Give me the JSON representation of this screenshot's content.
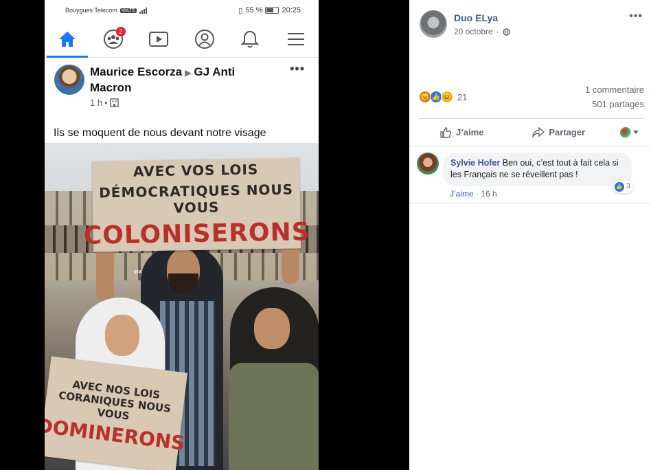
{
  "phone": {
    "status_bar": {
      "carrier": "Bouygues Telecom",
      "network_badge": "VoLTE",
      "battery": "55 %",
      "time": "20:25"
    },
    "nav_icons": [
      "home-icon",
      "groups-icon",
      "watch-icon",
      "profile-icon",
      "notifications-icon",
      "menu-icon"
    ],
    "groups_badge": "2",
    "post": {
      "author": "Maurice Escorza",
      "target": "GJ Anti Macron",
      "time": "1 h",
      "text": "Ils se moquent de nous devant notre visage",
      "sign_top": {
        "line1": "AVEC VOS LOIS",
        "line2": "DÉMOCRATIQUES NOUS VOUS",
        "line3": "COLONISERONS"
      },
      "sign_bottom": {
        "line1": "AVEC NOS LOIS",
        "line2": "CORANIQUES NOUS VOUS",
        "line3": "DOMINERONS"
      },
      "storefront": "WALL STREET"
    }
  },
  "panel": {
    "author": "Duo ELya",
    "date": "20 octobre",
    "reaction_count": "21",
    "comments_count": "1 commentaire",
    "shares_count": "501 partages",
    "like_label": "J’aime",
    "share_label": "Partager",
    "comment": {
      "author": "Sylvie Hofer",
      "text": "Ben oui, c’est tout à fait cela si les Français ne se réveillent pas !",
      "like_label": "J’aime",
      "separator": " · ",
      "time": "16 h",
      "reaction_count": "3"
    }
  },
  "colors": {
    "fb_blue": "#1877f2",
    "link_blue": "#385898",
    "badge_red": "#e41e3f",
    "sign_red": "#b8302a"
  }
}
